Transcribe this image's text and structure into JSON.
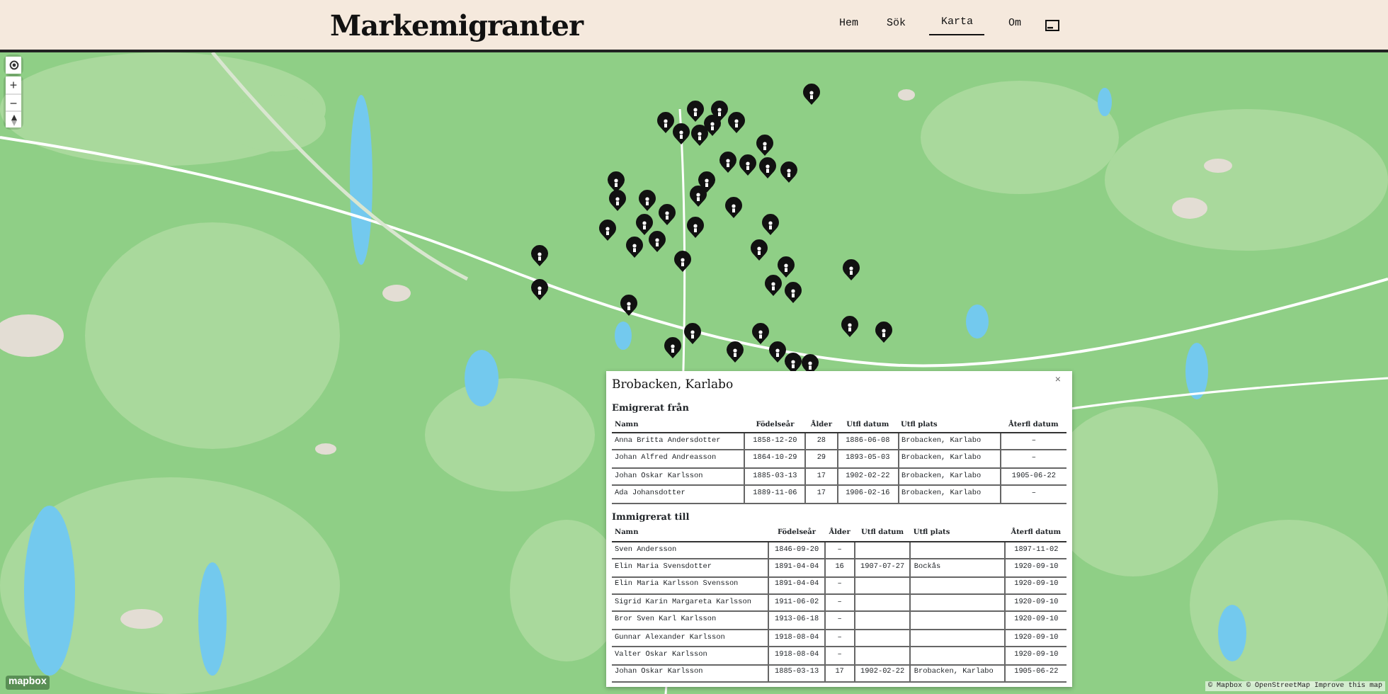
{
  "header": {
    "title": "Markemigranter",
    "nav": [
      {
        "label": "Hem",
        "selected": false
      },
      {
        "label": "Sök",
        "selected": false
      },
      {
        "label": "Karta",
        "selected": true
      },
      {
        "label": "Om",
        "selected": false
      }
    ]
  },
  "map_controls": {
    "zoom_in": "+",
    "zoom_out": "−"
  },
  "popup": {
    "title": "Brobacken, Karlabo",
    "close": "×",
    "sections": [
      {
        "title": "Emigrerat från",
        "columns": [
          "Namn",
          "Födelseår",
          "Ålder",
          "Utfl datum",
          "Utfl plats",
          "Återfl datum"
        ],
        "rows": [
          [
            "Anna Britta Andersdotter",
            "1858-12-20",
            "28",
            "1886-06-08",
            "Brobacken, Karlabo",
            "–"
          ],
          [
            "Johan Alfred Andreasson",
            "1864-10-29",
            "29",
            "1893-05-03",
            "Brobacken, Karlabo",
            "–"
          ],
          [
            "Johan Oskar Karlsson",
            "1885-03-13",
            "17",
            "1902-02-22",
            "Brobacken, Karlabo",
            "1905-06-22"
          ],
          [
            "Ada Johansdotter",
            "1889-11-06",
            "17",
            "1906-02-16",
            "Brobacken, Karlabo",
            "–"
          ]
        ]
      },
      {
        "title": "Immigrerat till",
        "columns": [
          "Namn",
          "Födelseår",
          "Ålder",
          "Utfl datum",
          "Utfl plats",
          "Återfl datum"
        ],
        "rows": [
          [
            "Sven Andersson",
            "1846-09-20",
            "–",
            null,
            null,
            "1897-11-02"
          ],
          [
            "Elin Maria Svensdotter",
            "1891-04-04",
            "16",
            "1907-07-27",
            "Bockås",
            "1920-09-10"
          ],
          [
            "Elin Maria Karlsson Svensson",
            "1891-04-04",
            "–",
            null,
            null,
            "1920-09-10"
          ],
          [
            "Sigrid Karin Margareta Karlsson",
            "1911-06-02",
            "–",
            null,
            null,
            "1920-09-10"
          ],
          [
            "Bror Sven Karl Karlsson",
            "1913-06-18",
            "–",
            null,
            null,
            "1920-09-10"
          ],
          [
            "Gunnar Alexander Karlsson",
            "1918-08-04",
            "–",
            null,
            null,
            "1920-09-10"
          ],
          [
            "Valter Oskar Karlsson",
            "1918-08-04",
            "–",
            null,
            null,
            "1920-09-10"
          ],
          [
            "Johan Oskar Karlsson",
            "1885-03-13",
            "17",
            "1902-02-22",
            "Brobacken, Karlabo",
            "1905-06-22"
          ]
        ]
      }
    ]
  },
  "attribution": {
    "logo": "mapbox",
    "links": [
      "© Mapbox",
      "© OpenStreetMap",
      "Improve this map"
    ]
  }
}
